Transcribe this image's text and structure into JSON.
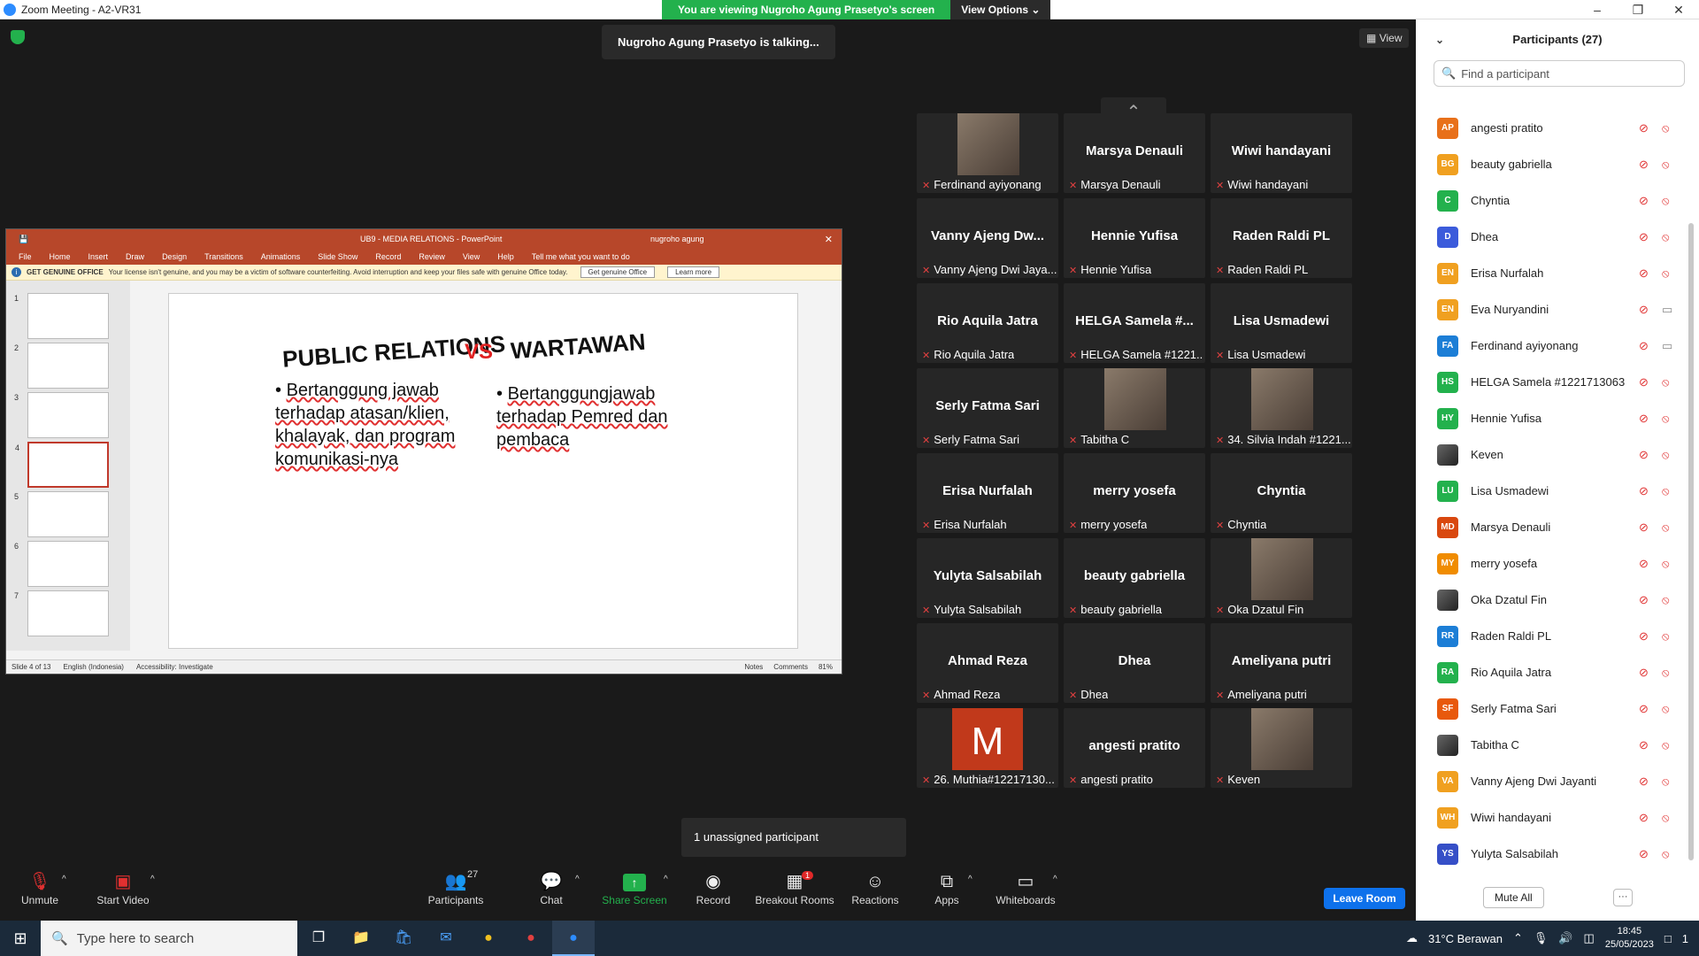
{
  "window": {
    "title": "Zoom Meeting - A2-VR31"
  },
  "banner": {
    "viewing": "You are viewing Nugroho Agung Prasetyo's screen",
    "view_options": "View Options"
  },
  "talking": "Nugroho Agung Prasetyo is talking...",
  "view_label": "View",
  "ppt": {
    "doc_title": "UB9 - MEDIA RELATIONS - PowerPoint",
    "user": "nugroho agung",
    "ribbon": [
      "File",
      "Home",
      "Insert",
      "Draw",
      "Design",
      "Transitions",
      "Animations",
      "Slide Show",
      "Record",
      "Review",
      "View",
      "Help",
      "Tell me what you want to do"
    ],
    "warning_title": "GET GENUINE OFFICE",
    "warning_text": "Your license isn't genuine, and you may be a victim of software counterfeiting. Avoid interruption and keep your files safe with genuine Office today.",
    "warning_btn1": "Get genuine Office",
    "warning_btn2": "Learn more",
    "thumb_numbers": [
      "1",
      "2",
      "3",
      "4",
      "5",
      "6",
      "7"
    ],
    "slide": {
      "heading_left": "PUBLIC RELATIONS",
      "vs": "VS",
      "heading_right": "WARTAWAN",
      "bullet_left": "Bertanggung jawab terhadap atasan/klien, khalayak, dan program komunikasi-nya",
      "bullet_right": "Bertanggungjawab terhadap Pemred dan pembaca"
    },
    "status": {
      "slide_of": "Slide 4 of 13",
      "language": "English (Indonesia)",
      "accessibility": "Accessibility: Investigate",
      "notes": "Notes",
      "comments": "Comments",
      "zoom": "81%"
    }
  },
  "tiles": [
    {
      "big": "",
      "name": "Ferdinand ayiyonang",
      "type": "photo"
    },
    {
      "big": "Marsya Denauli",
      "name": "Marsya Denauli",
      "type": "text"
    },
    {
      "big": "Wiwi handayani",
      "name": "Wiwi handayani",
      "type": "text"
    },
    {
      "big": "Vanny Ajeng Dw...",
      "name": "Vanny Ajeng Dwi Jaya...",
      "type": "text"
    },
    {
      "big": "Hennie Yufisa",
      "name": "Hennie Yufisa",
      "type": "text"
    },
    {
      "big": "Raden Raldi PL",
      "name": "Raden Raldi PL",
      "type": "text"
    },
    {
      "big": "Rio Aquila Jatra",
      "name": "Rio Aquila Jatra",
      "type": "text"
    },
    {
      "big": "HELGA Samela #...",
      "name": "HELGA Samela #1221...",
      "type": "text"
    },
    {
      "big": "Lisa Usmadewi",
      "name": "Lisa Usmadewi",
      "type": "text"
    },
    {
      "big": "Serly Fatma Sari",
      "name": "Serly Fatma Sari",
      "type": "text"
    },
    {
      "big": "",
      "name": "Tabitha C",
      "type": "photo"
    },
    {
      "big": "",
      "name": "34. Silvia Indah #1221...",
      "type": "photo"
    },
    {
      "big": "Erisa Nurfalah",
      "name": "Erisa Nurfalah",
      "type": "text"
    },
    {
      "big": "merry yosefa",
      "name": "merry yosefa",
      "type": "text"
    },
    {
      "big": "Chyntia",
      "name": "Chyntia",
      "type": "text"
    },
    {
      "big": "Yulyta Salsabilah",
      "name": "Yulyta Salsabilah",
      "type": "text"
    },
    {
      "big": "beauty gabriella",
      "name": "beauty gabriella",
      "type": "text"
    },
    {
      "big": "",
      "name": "Oka Dzatul Fin",
      "type": "photo"
    },
    {
      "big": "Ahmad Reza",
      "name": "Ahmad Reza",
      "type": "text"
    },
    {
      "big": "Dhea",
      "name": "Dhea",
      "type": "text"
    },
    {
      "big": "Ameliyana putri",
      "name": "Ameliyana putri",
      "type": "text"
    },
    {
      "big": "M",
      "name": "26. Muthia#12217130...",
      "type": "letter"
    },
    {
      "big": "angesti pratito",
      "name": "angesti pratito",
      "type": "text"
    },
    {
      "big": "",
      "name": "Keven",
      "type": "photo"
    }
  ],
  "unassigned": "1 unassigned participant",
  "toolbar": {
    "unmute": "Unmute",
    "start_video": "Start Video",
    "participants": "Participants",
    "participants_count": "27",
    "chat": "Chat",
    "share_screen": "Share Screen",
    "record": "Record",
    "breakout_rooms": "Breakout Rooms",
    "breakout_badge": "1",
    "reactions": "Reactions",
    "apps": "Apps",
    "whiteboards": "Whiteboards",
    "leave": "Leave Room"
  },
  "panel": {
    "title": "Participants (27)",
    "search_placeholder": "Find a participant",
    "mute_all": "Mute All",
    "more": "···",
    "participants": [
      {
        "initials": "AP",
        "name": "angesti pratito",
        "color": "#e8701a",
        "video": "off"
      },
      {
        "initials": "BG",
        "name": "beauty gabriella",
        "color": "#f0a020",
        "video": "off"
      },
      {
        "initials": "C",
        "name": "Chyntia",
        "color": "#23b14d",
        "video": "off"
      },
      {
        "initials": "D",
        "name": "Dhea",
        "color": "#3b5bdb",
        "video": "off"
      },
      {
        "initials": "EN",
        "name": "Erisa Nurfalah",
        "color": "#f0a020",
        "video": "off"
      },
      {
        "initials": "EN",
        "name": "Eva Nuryandini",
        "color": "#f0a020",
        "video": "on"
      },
      {
        "initials": "FA",
        "name": "Ferdinand ayiyonang",
        "color": "#1c7ed6",
        "video": "on"
      },
      {
        "initials": "HS",
        "name": "HELGA Samela #1221713063",
        "color": "#23b14d",
        "video": "off"
      },
      {
        "initials": "HY",
        "name": "Hennie Yufisa",
        "color": "#23b14d",
        "video": "off"
      },
      {
        "initials": "",
        "name": "Keven",
        "color": "#444444",
        "video": "off"
      },
      {
        "initials": "LU",
        "name": "Lisa Usmadewi",
        "color": "#23b14d",
        "video": "off"
      },
      {
        "initials": "MD",
        "name": "Marsya Denauli",
        "color": "#d9480f",
        "video": "off"
      },
      {
        "initials": "MY",
        "name": "merry yosefa",
        "color": "#f08c00",
        "video": "off"
      },
      {
        "initials": "",
        "name": "Oka Dzatul Fin",
        "color": "#444444",
        "video": "off"
      },
      {
        "initials": "RR",
        "name": "Raden Raldi PL",
        "color": "#1c7ed6",
        "video": "off"
      },
      {
        "initials": "RA",
        "name": "Rio Aquila Jatra",
        "color": "#23b14d",
        "video": "off"
      },
      {
        "initials": "SF",
        "name": "Serly Fatma Sari",
        "color": "#e8590c",
        "video": "off"
      },
      {
        "initials": "",
        "name": "Tabitha C",
        "color": "#444444",
        "video": "off"
      },
      {
        "initials": "VA",
        "name": "Vanny Ajeng Dwi Jayanti",
        "color": "#f0a020",
        "video": "off"
      },
      {
        "initials": "WH",
        "name": "Wiwi handayani",
        "color": "#f0a020",
        "video": "off"
      },
      {
        "initials": "YS",
        "name": "Yulyta Salsabilah",
        "color": "#364fc7",
        "video": "off"
      }
    ]
  },
  "taskbar": {
    "search_placeholder": "Type here to search",
    "weather": "31°C  Berawan",
    "time": "18:45",
    "date": "25/05/2023",
    "notif": "1"
  }
}
